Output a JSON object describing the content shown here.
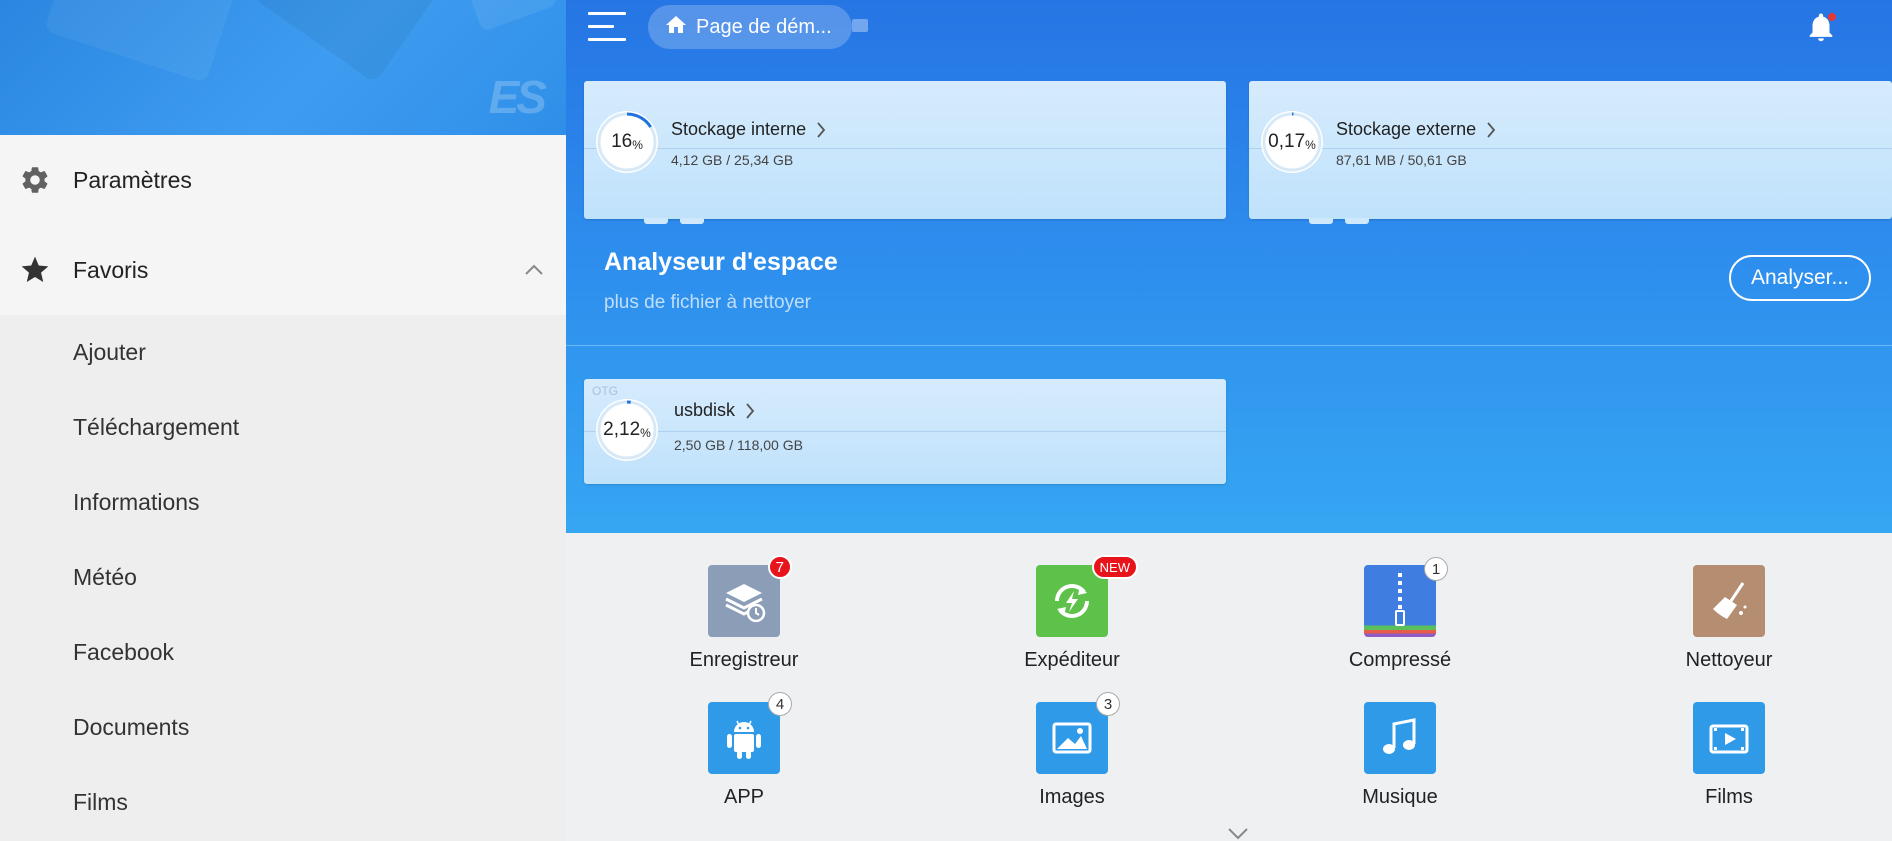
{
  "drawer": {
    "logo": "ES",
    "settings_label": "Paramètres",
    "favorites_label": "Favoris",
    "favorites_items": [
      {
        "label": "Ajouter"
      },
      {
        "label": "Téléchargement"
      },
      {
        "label": "Informations"
      },
      {
        "label": "Météo"
      },
      {
        "label": "Facebook"
      },
      {
        "label": "Documents"
      },
      {
        "label": "Films"
      }
    ]
  },
  "header": {
    "breadcrumb": "Page de dém...",
    "notification_dot_color": "#e53935"
  },
  "storage": {
    "internal": {
      "percent": "16",
      "percent_unit": "%",
      "used_fraction": 0.16,
      "name": "Stockage interne",
      "size": "4,12 GB / 25,34 GB"
    },
    "external": {
      "percent": "0,17",
      "percent_unit": "%",
      "used_fraction": 0.0017,
      "name": "Stockage externe",
      "size": "87,61 MB / 50,61 GB"
    },
    "usb": {
      "tag": "OTG",
      "percent": "2,12",
      "percent_unit": "%",
      "used_fraction": 0.0212,
      "name": "usbdisk",
      "size": "2,50 GB / 118,00 GB"
    }
  },
  "analyzer": {
    "title": "Analyseur d'espace",
    "subtitle": "plus de fichier à nettoyer",
    "button": "Analyser..."
  },
  "apps": [
    {
      "name": "Enregistreur",
      "icon": "recorder-icon",
      "color": "#8c9db8",
      "badge": "7",
      "badge_style": "red"
    },
    {
      "name": "Expéditeur",
      "icon": "sender-icon",
      "color": "#5ec14a",
      "badge": "NEW",
      "badge_style": "red"
    },
    {
      "name": "Compressé",
      "icon": "zip-icon",
      "color": "#3f7ee0",
      "badge": "1",
      "badge_style": "white"
    },
    {
      "name": "Nettoyeur",
      "icon": "broom-icon",
      "color": "#b58e72",
      "badge": "",
      "badge_style": "none"
    },
    {
      "name": "APP",
      "icon": "android-icon",
      "color": "#2f9ae8",
      "badge": "4",
      "badge_style": "white"
    },
    {
      "name": "Images",
      "icon": "image-icon",
      "color": "#2f9ae8",
      "badge": "3",
      "badge_style": "white"
    },
    {
      "name": "Musique",
      "icon": "music-icon",
      "color": "#2f9ae8",
      "badge": "",
      "badge_style": "none"
    },
    {
      "name": "Films",
      "icon": "video-icon",
      "color": "#2f9ae8",
      "badge": "",
      "badge_style": "none"
    }
  ],
  "colors": {
    "accent_blue": "#2675e4",
    "badge_red": "#e8141c"
  }
}
